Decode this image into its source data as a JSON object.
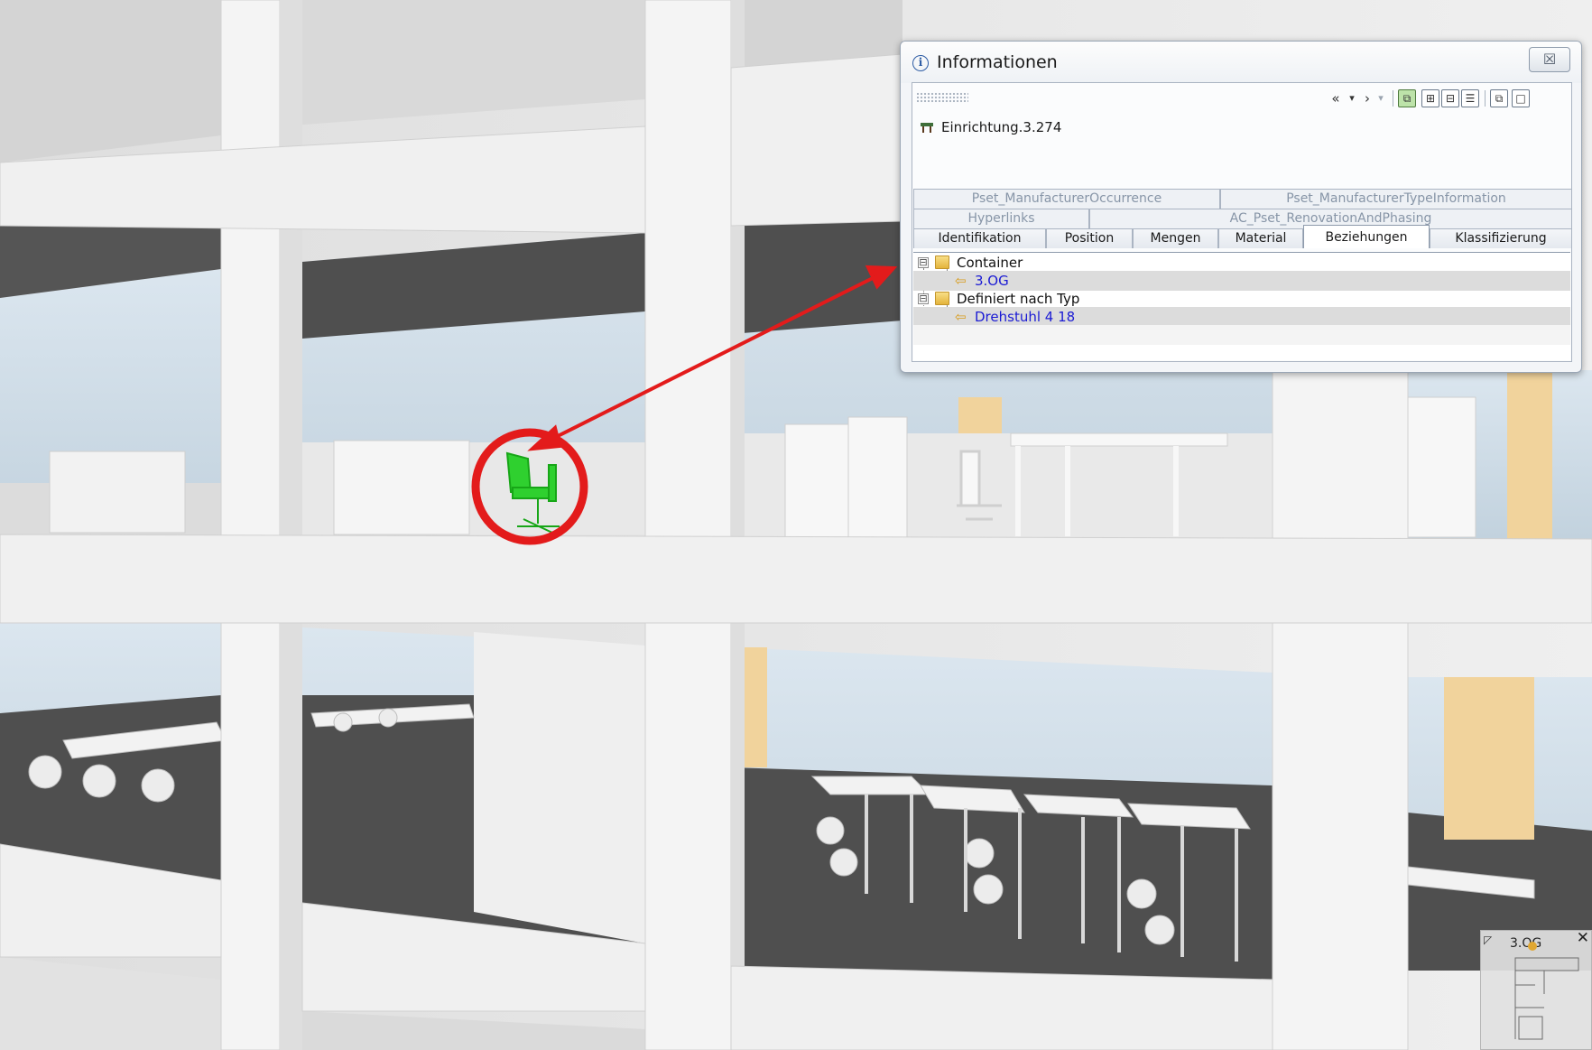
{
  "dialog": {
    "title": "Informationen",
    "close_glyph": "☒",
    "toolbar": {
      "back": "«",
      "dropdown": "▾",
      "forward": "›",
      "dropdown2": "▾",
      "btn_active": "⧉",
      "btn_expand": "⊞",
      "btn_collapse": "⊟",
      "btn_list": "☰",
      "btn_window": "⧉",
      "btn_max": "□"
    },
    "object": {
      "name": "Einrichtung.3.274",
      "icon": "chair-icon"
    },
    "tabs_row1": [
      "Pset_ManufacturerOccurrence",
      "Pset_ManufacturerTypeInformation"
    ],
    "tabs_row2": [
      "Hyperlinks",
      "AC_Pset_RenovationAndPhasing"
    ],
    "tabs_row3": [
      "Identifikation",
      "Position",
      "Mengen",
      "Material",
      "Beziehungen",
      "Klassifizierung"
    ],
    "active_tab": "Beziehungen",
    "tree": [
      {
        "type": "group",
        "label": "Container",
        "expander": "⊟"
      },
      {
        "type": "link",
        "label": "3.OG"
      },
      {
        "type": "group",
        "label": "Definiert nach Typ",
        "expander": "⊟"
      },
      {
        "type": "link",
        "label": "Drehstuhl 4 18"
      }
    ]
  },
  "minimap": {
    "label": "3.OG",
    "corner_glyph": "◸",
    "close_glyph": "✕"
  },
  "colors": {
    "highlight_circle": "#e31b1b",
    "arrow": "#e31b1b",
    "selected_chair": "#2fd02f",
    "link": "#1b1bd4",
    "floor_dark": "#4f4f4f",
    "facade": "#e4e4e4"
  }
}
